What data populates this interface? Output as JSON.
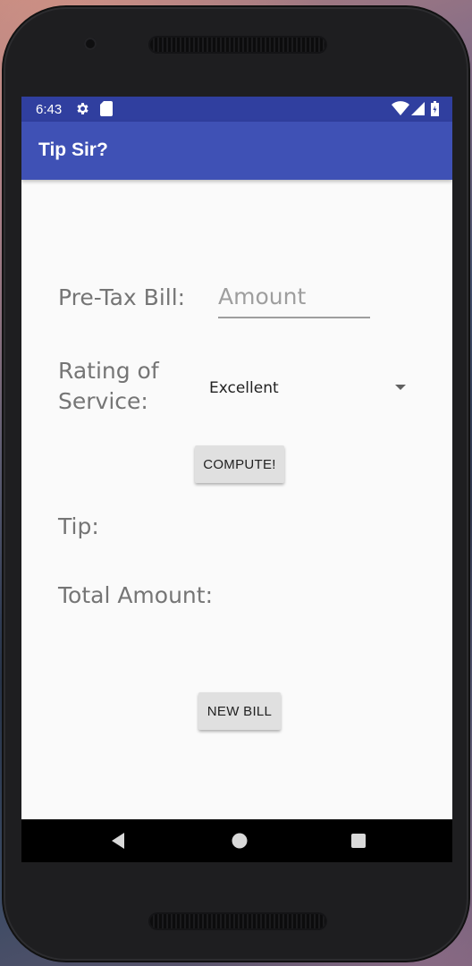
{
  "status_bar": {
    "time": "6:43",
    "icons": [
      "settings-icon",
      "sd-card-icon",
      "wifi-icon",
      "cell-signal-icon",
      "battery-icon"
    ]
  },
  "app_bar": {
    "title": "Tip Sir?"
  },
  "form": {
    "bill_label": "Pre-Tax Bill:",
    "amount_placeholder": "Amount",
    "amount_value": "",
    "rating_label_line1": "Rating of",
    "rating_label_line2": "Service:",
    "rating_selected": "Excellent",
    "compute_label": "COMPUTE!",
    "tip_label": "Tip:",
    "total_label": "Total Amount:",
    "new_bill_label": "NEW BILL"
  },
  "nav_bar": {
    "buttons": [
      "back-icon",
      "home-icon",
      "recents-icon"
    ]
  },
  "colors": {
    "status_bar": "#303f9f",
    "app_bar": "#3f51b5",
    "screen_bg": "#fafafa",
    "label_text": "#757575",
    "button_bg": "#e0e0e0"
  }
}
